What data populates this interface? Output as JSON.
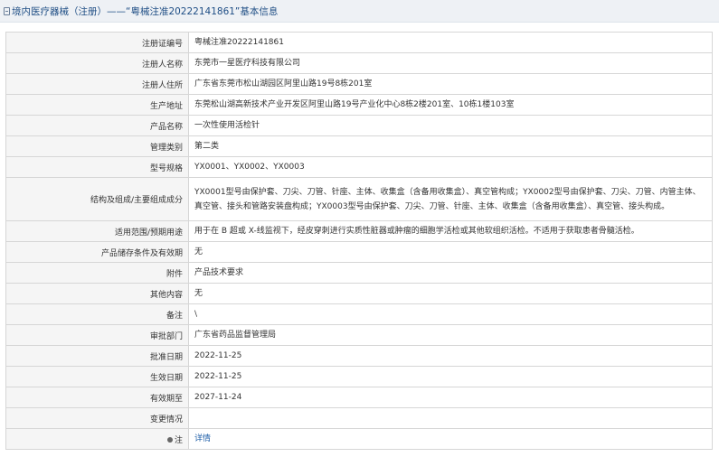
{
  "header": {
    "title": "境内医疗器械（注册）——“粤械注准20222141861”基本信息"
  },
  "rows": [
    {
      "label": "注册证编号",
      "value": "粤械注准20222141861"
    },
    {
      "label": "注册人名称",
      "value": "东莞市一星医疗科技有限公司"
    },
    {
      "label": "注册人住所",
      "value": "广东省东莞市松山湖园区阿里山路19号8栋201室"
    },
    {
      "label": "生产地址",
      "value": "东莞松山湖高新技术产业开发区阿里山路19号产业化中心8栋2楼201室、10栋1楼103室"
    },
    {
      "label": "产品名称",
      "value": "一次性使用活检针"
    },
    {
      "label": "管理类别",
      "value": "第二类"
    },
    {
      "label": "型号规格",
      "value": "YX0001、YX0002、YX0003"
    },
    {
      "label": "结构及组成/主要组成成分",
      "value": "YX0001型号由保护套、刀尖、刀管、针座、主体、收集盒（含备用收集盒）、真空管构成；YX0002型号由保护套、刀尖、刀管、内管主体、真空管、接头和管路安装盘构成；YX0003型号由保护套、刀尖、刀管、针座、主体、收集盒（含备用收集盒）、真空管、接头构成。"
    },
    {
      "label": "适用范围/预期用途",
      "value": "用于在 B 超或 X-线监视下，经皮穿刺进行实质性脏器或肿瘤的细胞学活检或其他软组织活检。不适用于获取患者骨髓活检。"
    },
    {
      "label": "产品储存条件及有效期",
      "value": "无"
    },
    {
      "label": "附件",
      "value": "产品技术要求"
    },
    {
      "label": "其他内容",
      "value": "无"
    },
    {
      "label": "备注",
      "value": "\\"
    },
    {
      "label": "审批部门",
      "value": "广东省药品监督管理局"
    },
    {
      "label": "批准日期",
      "value": "2022-11-25"
    },
    {
      "label": "生效日期",
      "value": "2022-11-25"
    },
    {
      "label": "有效期至",
      "value": "2027-11-24"
    },
    {
      "label": "变更情况",
      "value": ""
    }
  ],
  "footer_row": {
    "label": "注",
    "link": "详情"
  },
  "colors": {
    "link": "#1f5fa8",
    "title": "#1f4e85",
    "label_bg": "#f5f5f5",
    "border": "#d6d6d6"
  }
}
